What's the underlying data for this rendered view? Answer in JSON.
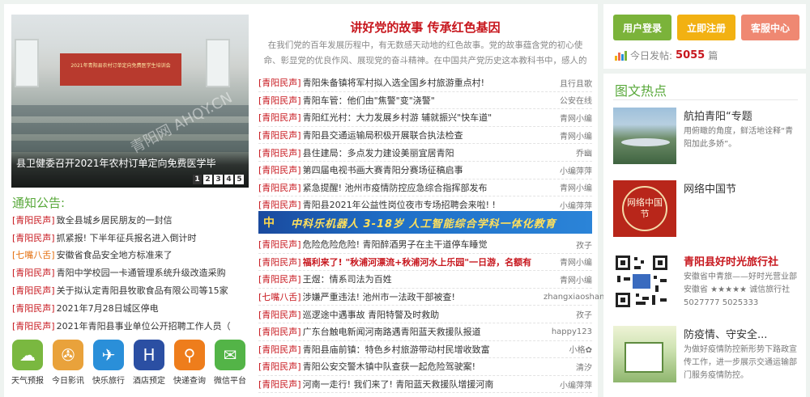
{
  "slideshow": {
    "caption": "县卫健委召开2021年农村订单定向免费医学毕",
    "watermark": "青阳网 AHQY.CN",
    "screen_text": "2021年青阳县农村订单定向免费医学生培训会",
    "pages": [
      "1",
      "2",
      "3",
      "4",
      "5"
    ],
    "active_page": "1"
  },
  "headline": {
    "title": "讲好党的故事 传承红色基因",
    "lede": "在我们党的百年发展历程中，有无数感天动地的红色故事。党的故事蕴含党的初心使命、彰显党的优良作风、展现党的奋斗精神。在中国共产党历史这本教科书中，感人的红色"
  },
  "news": [
    {
      "tag": "[青阳民声]",
      "title": "青阳朱备镇将军村拟入选全国乡村旅游重点村!",
      "author": "且行且歌",
      "red": false
    },
    {
      "tag": "[青阳民声]",
      "title": "青阳车管：他们由\"焦警\"变\"浇警\"",
      "author": "公安在线",
      "red": false
    },
    {
      "tag": "[青阳民声]",
      "title": "青阳红光村：大力发展乡村游 辅就振兴\"快车道\"",
      "author": "青网小编",
      "red": false
    },
    {
      "tag": "[青阳民声]",
      "title": "青阳县交通运输局积极开展联合执法检查",
      "author": "青网小编",
      "red": false
    },
    {
      "tag": "[青阳民声]",
      "title": "县住建局：多点发力建设美丽宜居青阳",
      "author": "乔幽",
      "red": false
    },
    {
      "tag": "[青阳民声]",
      "title": "第四届电视书画大赛青阳分赛场征稿启事",
      "author": "小编萍萍",
      "red": false
    },
    {
      "tag": "[青阳民声]",
      "title": "紧急提醒! 池州市疫情防控应急综合指挥部发布",
      "author": "青网小编",
      "red": false
    },
    {
      "tag": "[青阳民声]",
      "title": "青阳县2021年公益性岗位夜市专场招聘会来啦! !",
      "author": "小编萍萍",
      "red": false
    }
  ],
  "banner": {
    "logo": "中",
    "text": "中科乐机器人 3-18岁 人工智能综合学科一体化教育"
  },
  "news2": [
    {
      "tag": "[青阳民声]",
      "title": "危险危险危险! 青阳醉酒男子在主干道停车睡觉",
      "author": "孜子",
      "red": false
    },
    {
      "tag": "[青阳民声]",
      "title": "福利来了! \"秋浦河漂流+秋浦河水上乐园\"一日游，名额有",
      "author": "青网小编",
      "red": true
    },
    {
      "tag": "[青阳民声]",
      "title": "王煜：情系司法为百姓",
      "author": "青网小编",
      "red": false
    },
    {
      "tag": "[七嘴八舌]",
      "title": "涉嫌严重违法! 池州市一法政干部被查!",
      "author": "zhangxiaoshan",
      "red": false
    },
    {
      "tag": "[青阳民声]",
      "title": "巡逻途中遇事故 青阳特警及时救助",
      "author": "孜子",
      "red": false
    },
    {
      "tag": "[青阳民声]",
      "title": "广东台触电新闻河南路遇青阳蓝天救援队报道",
      "author": "happy123",
      "red": false
    },
    {
      "tag": "[青阳民声]",
      "title": "青阳县庙前镇：特色乡村旅游带动村民增收致富",
      "author": "小格✿",
      "red": false
    },
    {
      "tag": "[青阳民声]",
      "title": "青阳公安交警木镇中队查获一起危险驾驶案!",
      "author": "清汐",
      "red": false
    },
    {
      "tag": "[青阳民声]",
      "title": "河南一走行! 我们来了! 青阳蓝天救援队增援河南",
      "author": "小编萍萍",
      "red": false
    }
  ],
  "notice": {
    "title": "通知公告:",
    "items": [
      {
        "tag": "[青阳民声]",
        "text": "致全县城乡居民朋友的一封信",
        "orange": false
      },
      {
        "tag": "[青阳民声]",
        "text": "抓紧报! 下半年征兵报名进入倒计时",
        "orange": false
      },
      {
        "tag": "[七嘴八舌]",
        "text": "安徽省食品安全地方标准来了",
        "orange": true
      },
      {
        "tag": "[青阳民声]",
        "text": "青阳中学校园一卡通管理系统升级改造采购",
        "orange": false
      },
      {
        "tag": "[青阳民声]",
        "text": "关于拟认定青阳县牧歌食品有限公司等15家",
        "orange": false
      },
      {
        "tag": "[青阳民声]",
        "text": "2021年7月28日城区停电",
        "orange": false
      },
      {
        "tag": "[青阳民声]",
        "text": "2021年青阳县事业单位公开招聘工作人员（",
        "orange": false
      }
    ]
  },
  "apps": [
    {
      "label": "天气预报",
      "icon": "weather-icon",
      "glyph": "☁",
      "color": "#7ab840"
    },
    {
      "label": "今日影讯",
      "icon": "film-icon",
      "glyph": "✇",
      "color": "#e9a23b"
    },
    {
      "label": "快乐旅行",
      "icon": "travel-icon",
      "glyph": "✈",
      "color": "#2a8fd9"
    },
    {
      "label": "酒店预定",
      "icon": "hotel-icon",
      "glyph": "H",
      "color": "#2b4fa3"
    },
    {
      "label": "快递查询",
      "icon": "search-icon",
      "glyph": "⚲",
      "color": "#ee7d1c"
    },
    {
      "label": "微信平台",
      "icon": "wechat-icon",
      "glyph": "✉",
      "color": "#53b447"
    }
  ],
  "account": {
    "login": "用户登录",
    "register": "立即注册",
    "service": "客服中心",
    "post_label": "今日发帖:",
    "post_count": "5055",
    "post_unit": "篇"
  },
  "hotspot": {
    "title": "图文热点",
    "items": [
      {
        "name": "航拍青阳“专题",
        "desc": "用俯瞰的角度，鲜活地诠释“青阳加此多娇”。",
        "red": false
      },
      {
        "name": "网络中国节",
        "desc": "",
        "red": false,
        "thumb_text": "网络中国节"
      },
      {
        "name": "青阳县好时光旅行社",
        "desc": "安徽省中青旅——好时光营业部 安徽省 ★★★★★ 诚信旅行社 5027777 5025333",
        "red": true
      },
      {
        "name": "防疫情、守安全...",
        "desc": "为做好疫情防控新形势下路政宣传工作，进一步展示交通运输部门服务疫情防控。",
        "red": false
      }
    ]
  }
}
